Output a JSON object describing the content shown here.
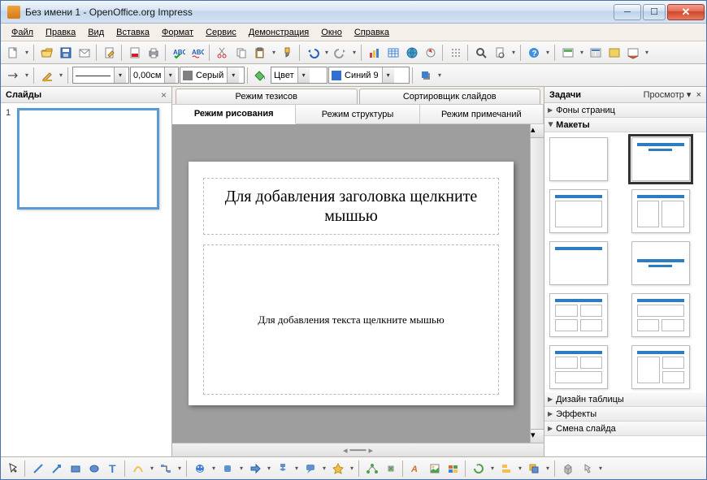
{
  "window": {
    "title": "Без имени 1 - OpenOffice.org Impress"
  },
  "menu": {
    "file": "Файл",
    "edit": "Правка",
    "view": "Вид",
    "insert": "Вставка",
    "format": "Формат",
    "tools": "Сервис",
    "slideshow": "Демонстрация",
    "window": "Окно",
    "help": "Справка"
  },
  "toolbar2": {
    "width": "0,00см",
    "color1": "Серый",
    "fill_label": "Цвет",
    "color2": "Синий 9"
  },
  "panels": {
    "slides_title": "Слайды",
    "tasks_title": "Задачи",
    "tasks_view": "Просмотр"
  },
  "view_tabs": {
    "outline_top": "Режим тезисов",
    "slide_sorter": "Сортировщик слайдов",
    "drawing": "Режим рисования",
    "outline": "Режим структуры",
    "notes": "Режим примечаний"
  },
  "slide": {
    "title_placeholder": "Для добавления заголовка щелкните мышью",
    "body_placeholder": "Для добавления текста щелкните мышью",
    "number": "1"
  },
  "task_sections": {
    "master": "Фоны страниц",
    "layouts": "Макеты",
    "table": "Дизайн таблицы",
    "effects": "Эффекты",
    "transition": "Смена слайда"
  }
}
